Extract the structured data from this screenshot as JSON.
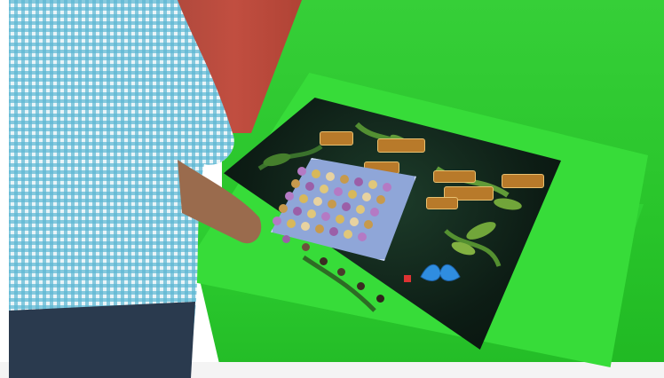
{
  "scene": {
    "kind": "photo",
    "colors": {
      "wall": "#2ac82c",
      "kiosk": "#37dc39",
      "red_wall": "#b94a3c",
      "screen_bg": "#0d1d15",
      "board": "#8fa6d8",
      "shirt_check": "#3fa6c9"
    },
    "game": {
      "labels": []
    },
    "icons": [
      "butterfly-icon"
    ]
  }
}
